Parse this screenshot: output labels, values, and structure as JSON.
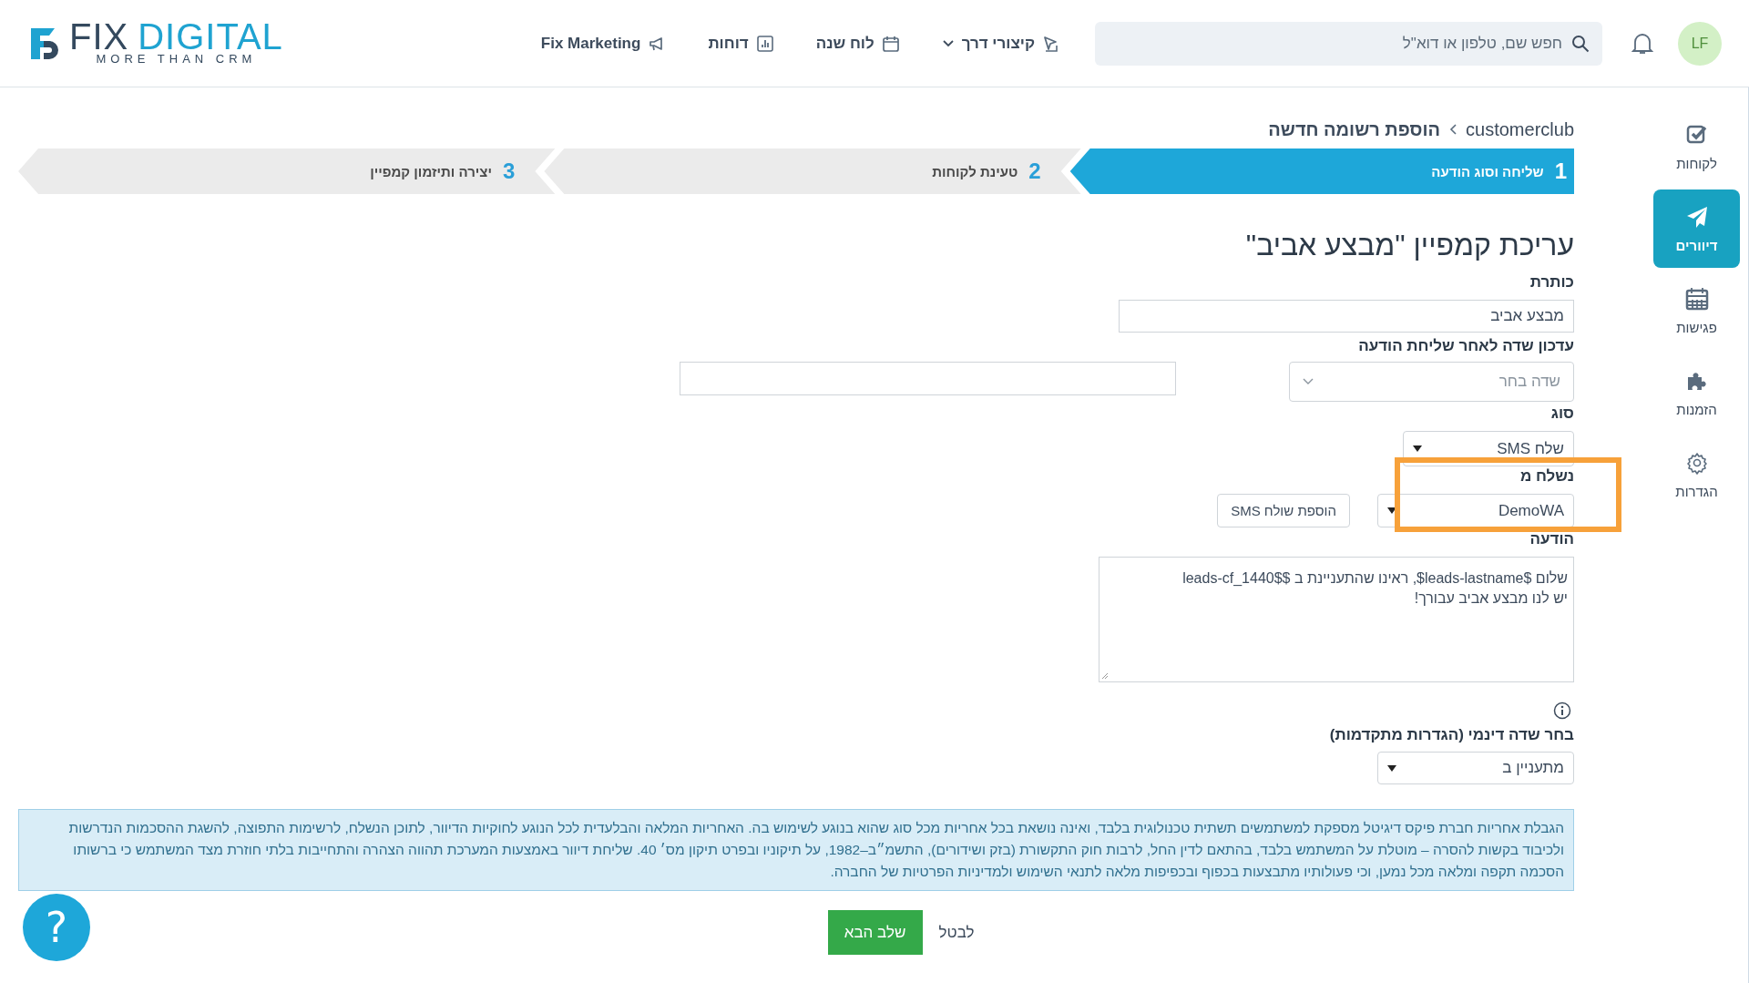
{
  "header": {
    "logo": {
      "word1": "FIX",
      "word2": "DIGITAL",
      "tagline": "MORE THAN CRM"
    },
    "nav": [
      {
        "label": "קיצורי דרך",
        "dropdown": true
      },
      {
        "label": "לוח שנה",
        "dropdown": false
      },
      {
        "label": "דוחות",
        "dropdown": false
      },
      {
        "label": "Fix Marketing",
        "dropdown": false
      }
    ],
    "search": {
      "placeholder": "חפש שם, טלפון או דוא\"ל"
    },
    "avatar": "LF"
  },
  "sidebar": {
    "items": [
      {
        "label": "לקוחות",
        "selected": false
      },
      {
        "label": "דיוורים",
        "selected": true
      },
      {
        "label": "פגישות",
        "selected": false
      },
      {
        "label": "הזמנות",
        "selected": false
      },
      {
        "label": "הגדרות",
        "selected": false
      }
    ]
  },
  "breadcrumb": [
    "customerclub",
    "הוספת רשומה חדשה"
  ],
  "steps": [
    {
      "number": "1",
      "label": "שליחה וסוג הודעה",
      "selected": true
    },
    {
      "number": "2",
      "label": "טעינת לקוחות",
      "selected": false
    },
    {
      "number": "3",
      "label": "יצירה ותיזמון קמפיין",
      "selected": false
    }
  ],
  "form": {
    "title": "עריכת קמפיין \"מבצע אביב\"",
    "subject": {
      "label": "כותרת",
      "value": "מבצע אביב"
    },
    "update_field": {
      "label": "עדכון שדה לאחר שליחת הודעה",
      "placeholder": "שדה בחר"
    },
    "type": {
      "label": "סוג",
      "value": "שלח SMS"
    },
    "sender": {
      "label": "נשלח מ",
      "value": "DemoWA",
      "add_button": "הוספת שולח SMS",
      "highlighted": true
    },
    "message": {
      "label": "הודעה",
      "value": "שלום $leads-lastname$, ראינו שהתעניינת ב $$leads-cf_1440\nיש לנו מבצע אביב עבורך!"
    },
    "dynamic_field": {
      "label": "בחר שדה דינמי (הגדרות מתקדמות)",
      "value": "מתעניין ב"
    }
  },
  "disclaimer": "הגבלת אחריות חברת פיקס דיגיטל מספקת למשתמשים תשתית טכנולוגית בלבד, ואינה נושאת בכל אחריות מכל סוג שהוא בנוגע לשימוש בה. האחריות המלאה והבלעדית לכל הנוגע לחוקיות הדיוור, לתוכן הנשלח, לרשימות התפוצה, להשגת ההסכמות הנדרשות ולכיבוד בקשות להסרה – מוטלת על המשתמש בלבד, בהתאם לדין החל, לרבות חוק התקשורת (בזק ושידורים), התשמ״ב–1982, על תיקוניו ובפרט תיקון מס׳ 40. שליחת דיוור באמצעות המערכת תהווה הצהרה והתחייבות בלתי חוזרת מצד המשתמש כי ברשותו הסכמה תקפה ומלאה מכל נמען, וכי פעולותיו מתבצעות בכפוף ובכפיפות מלאה לתנאי השימוש ולמדיניות הפרטיות של החברה.",
  "actions": {
    "next": "שלב הבא",
    "cancel": "לבטל"
  },
  "help": "?"
}
